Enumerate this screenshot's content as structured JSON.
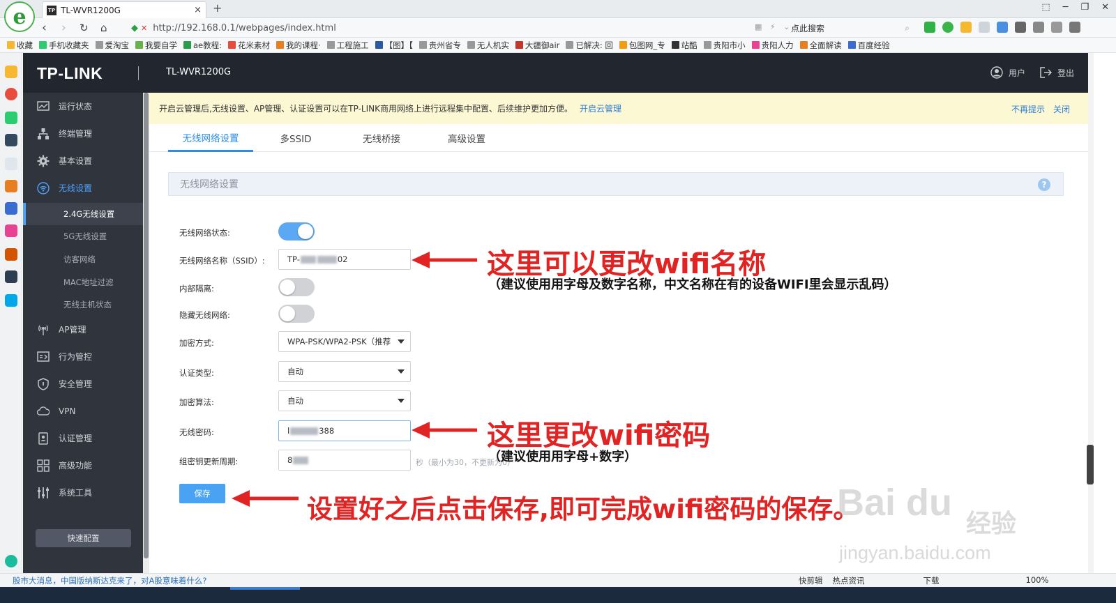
{
  "browser": {
    "tab_title": "TL-WVR1200G",
    "tab_close": "×",
    "new_tab": "+",
    "url": "http://192.168.0.1/webpages/index.html",
    "search_placeholder": "点此搜索",
    "bookmarks": [
      "收藏",
      "手机收藏夹",
      "爱淘宝",
      "我要自学",
      "ae教程:",
      "花米素材",
      "我的课程·",
      "工程施工",
      "【图】【",
      "贵州省专",
      "无人机实",
      "大疆御air",
      "已解决: 回",
      "包图网_专",
      "站酷",
      "贵阳市小",
      "贵阳人力",
      "全面解读",
      "百度经验"
    ]
  },
  "header": {
    "logo": "TP-LINK",
    "model": "TL-WVR1200G",
    "user_label": "用户",
    "logout_label": "登出"
  },
  "sidebar": {
    "items": [
      {
        "label": "运行状态",
        "icon": "monitor-icon"
      },
      {
        "label": "终端管理",
        "icon": "network-tree-icon"
      },
      {
        "label": "基本设置",
        "icon": "gear-icon"
      },
      {
        "label": "无线设置",
        "icon": "wifi-icon"
      },
      {
        "label": "AP管理",
        "icon": "antenna-icon"
      },
      {
        "label": "行为管控",
        "icon": "behavior-icon"
      },
      {
        "label": "安全管理",
        "icon": "shield-icon"
      },
      {
        "label": "VPN",
        "icon": "cloud-vpn-icon"
      },
      {
        "label": "认证管理",
        "icon": "id-card-icon"
      },
      {
        "label": "高级功能",
        "icon": "grid-icon"
      },
      {
        "label": "系统工具",
        "icon": "tools-icon"
      }
    ],
    "subitems": [
      "2.4G无线设置",
      "5G无线设置",
      "访客网络",
      "MAC地址过滤",
      "无线主机状态"
    ],
    "quick_config": "快速配置"
  },
  "notice": {
    "text": "开启云管理后,无线设置、AP管理、认证设置可以在TP-LINK商用网络上进行远程集中配置、后续维护更加方便。",
    "link": "开启云管理",
    "dismiss": "不再提示",
    "close": "关闭"
  },
  "tabs": [
    "无线网络设置",
    "多SSID",
    "无线桥接",
    "高级设置"
  ],
  "section_title": "无线网络设置",
  "form": {
    "status_label": "无线网络状态:",
    "ssid_label": "无线网络名称（SSID）:",
    "ssid_prefix": "TP-",
    "ssid_suffix": "02",
    "isolation_label": "内部隔离:",
    "hidden_label": "隐藏无线网络:",
    "encryption_label": "加密方式:",
    "encryption_value": "WPA-PSK/WPA2-PSK（推荐",
    "auth_label": "认证类型:",
    "auth_value": "自动",
    "algo_label": "加密算法:",
    "algo_value": "自动",
    "password_label": "无线密码:",
    "password_prefix": "l",
    "password_suffix": "388",
    "rekey_label": "组密钥更新周期:",
    "rekey_value": "8",
    "rekey_hint": "秒（最小为30，不更新为0）",
    "save": "保存"
  },
  "annotations": {
    "ssid_title": "这里可以更改wifi名称",
    "ssid_note": "（建议使用用字母及数字名称，中文名称在有的设备WIFI里会显示乱码）",
    "pwd_title": "这里更改wifi密码",
    "pwd_note": "（建议使用用字母+数字）",
    "save_note": "设置好之后点击保存,即可完成wifi密码的保存。"
  },
  "watermark": {
    "brand": "Bai du",
    "cn": "经验",
    "url": "jingyan.baidu.com"
  },
  "status_bar": {
    "news": "股市大消息，中国版纳斯达克来了，对A股意味着什么?",
    "items": [
      "快剪辑",
      "热点资讯",
      "下载",
      "100%"
    ]
  },
  "colors": {
    "header_bg": "#22262f",
    "sidebar_bg": "#30343d",
    "accent": "#2b8be6",
    "annotation_red": "#e02424",
    "notice_bg": "#fdf8d4"
  }
}
